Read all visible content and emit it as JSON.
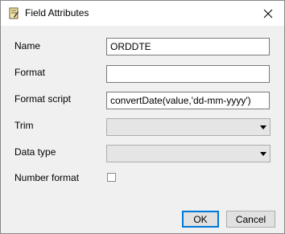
{
  "window": {
    "title": "Field Attributes",
    "icon": "document-edit-icon"
  },
  "form": {
    "name_label": "Name",
    "name_value": "ORDDTE",
    "format_label": "Format",
    "format_value": "",
    "format_script_label": "Format script",
    "format_script_value": "convertDate(value,'dd-mm-yyyy')",
    "trim_label": "Trim",
    "trim_value": "",
    "data_type_label": "Data type",
    "data_type_value": "",
    "number_format_label": "Number format",
    "number_format_checked": false
  },
  "buttons": {
    "ok": "OK",
    "cancel": "Cancel"
  }
}
